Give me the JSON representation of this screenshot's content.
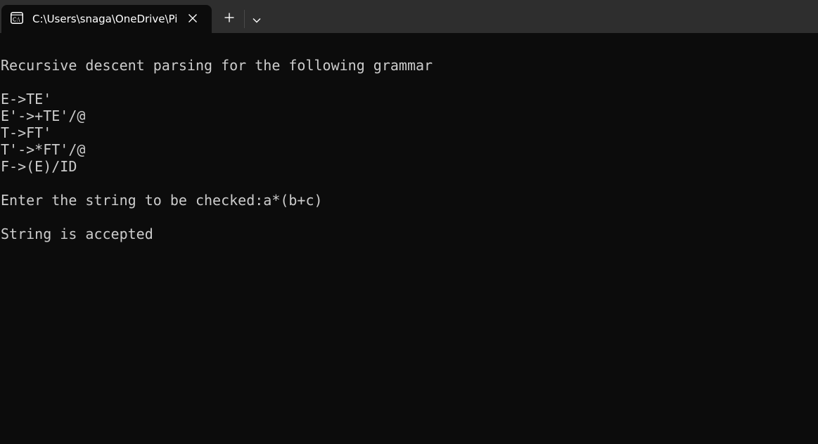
{
  "tab": {
    "title": "C:\\Users\\snaga\\OneDrive\\Pictures",
    "icon": "terminal-icon"
  },
  "tabbar": {
    "close_icon": "close-icon",
    "new_tab_icon": "plus-icon",
    "dropdown_icon": "chevron-down-icon"
  },
  "terminal": {
    "heading": "Recursive descent parsing for the following grammar",
    "grammar": [
      "E->TE'",
      "E'->+TE'/@",
      "T->FT'",
      "T'->*FT'/@",
      "F->(E)/ID"
    ],
    "prompt": "Enter the string to be checked:a*(b+c)",
    "result": "String is accepted"
  },
  "colors": {
    "background": "#0c0c0c",
    "text": "#cccccc",
    "tabbar": "#2e2e2e"
  }
}
